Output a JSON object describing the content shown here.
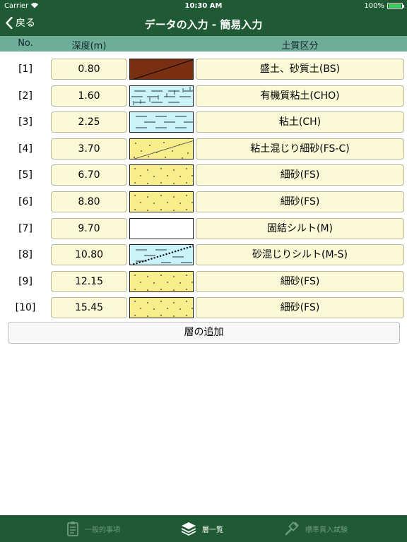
{
  "status": {
    "carrier": "Carrier",
    "time": "10:30 AM",
    "battery": "100%",
    "battery_level": 1.0
  },
  "nav": {
    "back_label": "戻る",
    "title": "データの入力 - 簡易入力"
  },
  "columns": {
    "no": "No.",
    "depth": "深度(m)",
    "soil": "土質区分"
  },
  "layers": [
    {
      "no": "[1]",
      "depth": "0.80",
      "soil": "盛土、砂質土(BS)",
      "pattern": "fill-icon"
    },
    {
      "no": "[2]",
      "depth": "1.60",
      "soil": "有機質粘土(CHO)",
      "pattern": "organic-clay-icon"
    },
    {
      "no": "[3]",
      "depth": "2.25",
      "soil": "粘土(CH)",
      "pattern": "clay-icon"
    },
    {
      "no": "[4]",
      "depth": "3.70",
      "soil": "粘土混じり細砂(FS-C)",
      "pattern": "clayey-sand-icon"
    },
    {
      "no": "[5]",
      "depth": "6.70",
      "soil": "細砂(FS)",
      "pattern": "fine-sand-icon"
    },
    {
      "no": "[6]",
      "depth": "8.80",
      "soil": "細砂(FS)",
      "pattern": "fine-sand-icon"
    },
    {
      "no": "[7]",
      "depth": "9.70",
      "soil": "固結シルト(M)",
      "pattern": "consolidated-silt-icon"
    },
    {
      "no": "[8]",
      "depth": "10.80",
      "soil": "砂混じりシルト(M-S)",
      "pattern": "sandy-silt-icon"
    },
    {
      "no": "[9]",
      "depth": "12.15",
      "soil": "細砂(FS)",
      "pattern": "fine-sand-icon"
    },
    {
      "no": "[10]",
      "depth": "15.45",
      "soil": "細砂(FS)",
      "pattern": "fine-sand-icon"
    }
  ],
  "add_layer_label": "層の追加",
  "tabs": [
    {
      "label": "一般的事項",
      "active": false,
      "icon": "clipboard-icon"
    },
    {
      "label": "層一覧",
      "active": true,
      "icon": "layers-icon"
    },
    {
      "label": "標準貫入試験",
      "active": false,
      "icon": "drill-icon"
    }
  ],
  "colors": {
    "bar": "#1f5a34",
    "header": "#6fae96",
    "field": "#fbf9d6",
    "fill_pattern": "#7a2f12",
    "clay_pattern": "#c9f3f6",
    "sand_pattern": "#f7ed8a"
  }
}
